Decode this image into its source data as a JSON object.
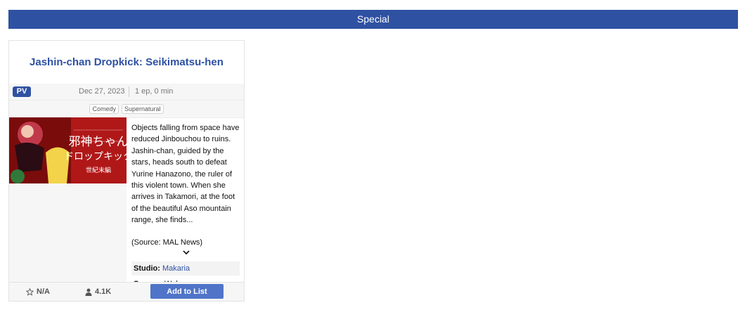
{
  "section": {
    "title": "Special"
  },
  "card": {
    "title": "Jashin-chan Dropkick: Seikimatsu-hen",
    "type_badge": "PV",
    "date": "Dec 27, 2023",
    "episodes": "1 ep, 0 min",
    "genres": [
      "Comedy",
      "Supernatural"
    ],
    "image_title_text": "邪神ちゃん ドロップキック 世紀末編",
    "synopsis": "Objects falling from space have reduced Jinbouchou to ruins. Jashin-chan, guided by the stars, heads south to defeat Yurine Hanazono, the ruler of this violent town. When she arrives in Takamori, at the foot of the beautiful Aso mountain range, she finds...",
    "source_note": "(Source: MAL News)",
    "studio_label": "Studio:",
    "studio_value": "Makaria",
    "source_label": "Source:",
    "source_value": "Web manga",
    "score": "N/A",
    "members": "4.1K",
    "add_button": "Add to List"
  },
  "icons": {
    "star": "star-outline-icon",
    "user": "user-icon",
    "expand": "chevron-down-icon"
  },
  "colors": {
    "accent": "#2e51a2",
    "button": "#4f74c8",
    "image_bg": "#9c1414"
  }
}
